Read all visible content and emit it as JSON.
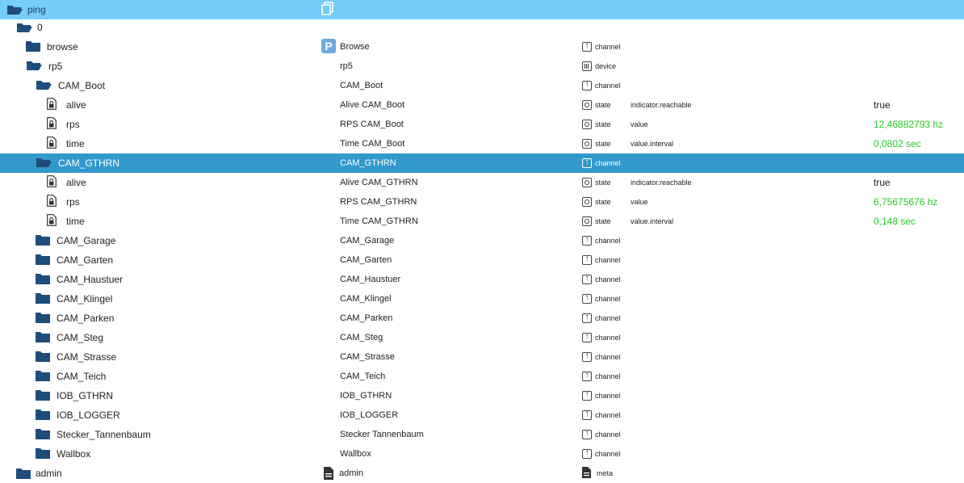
{
  "top": {
    "name": "ping",
    "copy_icon": "copy-icon"
  },
  "root0": {
    "name": "0",
    "p_label": "P"
  },
  "rows": [
    {
      "name": "browse",
      "label": "Browse",
      "type": "channel",
      "role": "",
      "value": ""
    },
    {
      "name": "rp5",
      "label": "rp5",
      "type": "device",
      "role": "",
      "value": ""
    },
    {
      "name": "CAM_Boot",
      "label": "CAM_Boot",
      "type": "channel",
      "role": "",
      "value": ""
    },
    {
      "name": "alive",
      "label": "Alive CAM_Boot",
      "type": "state",
      "role": "indicator.reachable",
      "value": "true"
    },
    {
      "name": "rps",
      "label": "RPS CAM_Boot",
      "type": "state",
      "role": "value",
      "value": "12,46882793 hz"
    },
    {
      "name": "time",
      "label": "Time CAM_Boot",
      "type": "state",
      "role": "value.interval",
      "value": "0,0802 sec"
    },
    {
      "name": "CAM_GTHRN",
      "label": "CAM_GTHRN",
      "type": "channel",
      "role": "",
      "value": ""
    },
    {
      "name": "alive",
      "label": "Alive CAM_GTHRN",
      "type": "state",
      "role": "indicator.reachable",
      "value": "true"
    },
    {
      "name": "rps",
      "label": "RPS CAM_GTHRN",
      "type": "state",
      "role": "value",
      "value": "6,75675676 hz"
    },
    {
      "name": "time",
      "label": "Time CAM_GTHRN",
      "type": "state",
      "role": "value.interval",
      "value": "0,148 sec"
    },
    {
      "name": "CAM_Garage",
      "label": "CAM_Garage",
      "type": "channel",
      "role": "",
      "value": ""
    },
    {
      "name": "CAM_Garten",
      "label": "CAM_Garten",
      "type": "channel",
      "role": "",
      "value": ""
    },
    {
      "name": "CAM_Haustuer",
      "label": "CAM_Haustuer",
      "type": "channel",
      "role": "",
      "value": ""
    },
    {
      "name": "CAM_Klingel",
      "label": "CAM_Klingel",
      "type": "channel",
      "role": "",
      "value": ""
    },
    {
      "name": "CAM_Parken",
      "label": "CAM_Parken",
      "type": "channel",
      "role": "",
      "value": ""
    },
    {
      "name": "CAM_Steg",
      "label": "CAM_Steg",
      "type": "channel",
      "role": "",
      "value": ""
    },
    {
      "name": "CAM_Strasse",
      "label": "CAM_Strasse",
      "type": "channel",
      "role": "",
      "value": ""
    },
    {
      "name": "CAM_Teich",
      "label": "CAM_Teich",
      "type": "channel",
      "role": "",
      "value": ""
    },
    {
      "name": "IOB_GTHRN",
      "label": "IOB_GTHRN",
      "type": "channel",
      "role": "",
      "value": ""
    },
    {
      "name": "IOB_LOGGER",
      "label": "IOB_LOGGER",
      "type": "channel",
      "role": "",
      "value": ""
    },
    {
      "name": "Stecker_Tannenbaum",
      "label": "Stecker Tannenbaum",
      "type": "channel",
      "role": "",
      "value": ""
    },
    {
      "name": "Wallbox",
      "label": "Wallbox",
      "type": "channel",
      "role": "",
      "value": ""
    }
  ],
  "admin": {
    "name": "admin",
    "label": "admin",
    "type": "meta"
  },
  "colors": {
    "folder": "#1e4d7b",
    "top_bar": "#76cdf8",
    "selected": "#3399cc",
    "value_green": "#22cc22"
  }
}
